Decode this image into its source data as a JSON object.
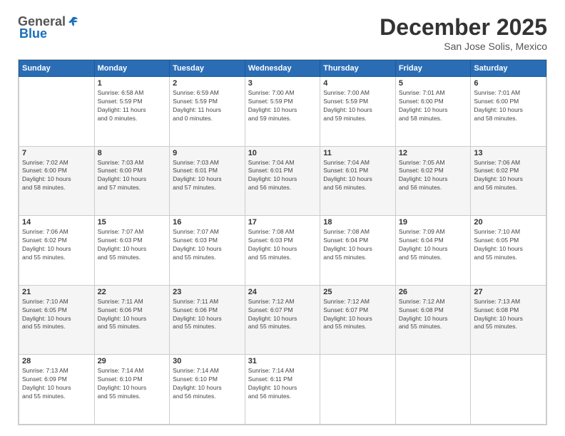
{
  "logo": {
    "general": "General",
    "blue": "Blue"
  },
  "title": "December 2025",
  "location": "San Jose Solis, Mexico",
  "days_header": [
    "Sunday",
    "Monday",
    "Tuesday",
    "Wednesday",
    "Thursday",
    "Friday",
    "Saturday"
  ],
  "weeks": [
    [
      {
        "day": "",
        "info": ""
      },
      {
        "day": "1",
        "info": "Sunrise: 6:58 AM\nSunset: 5:59 PM\nDaylight: 11 hours\nand 0 minutes."
      },
      {
        "day": "2",
        "info": "Sunrise: 6:59 AM\nSunset: 5:59 PM\nDaylight: 11 hours\nand 0 minutes."
      },
      {
        "day": "3",
        "info": "Sunrise: 7:00 AM\nSunset: 5:59 PM\nDaylight: 10 hours\nand 59 minutes."
      },
      {
        "day": "4",
        "info": "Sunrise: 7:00 AM\nSunset: 5:59 PM\nDaylight: 10 hours\nand 59 minutes."
      },
      {
        "day": "5",
        "info": "Sunrise: 7:01 AM\nSunset: 6:00 PM\nDaylight: 10 hours\nand 58 minutes."
      },
      {
        "day": "6",
        "info": "Sunrise: 7:01 AM\nSunset: 6:00 PM\nDaylight: 10 hours\nand 58 minutes."
      }
    ],
    [
      {
        "day": "7",
        "info": "Sunrise: 7:02 AM\nSunset: 6:00 PM\nDaylight: 10 hours\nand 58 minutes."
      },
      {
        "day": "8",
        "info": "Sunrise: 7:03 AM\nSunset: 6:00 PM\nDaylight: 10 hours\nand 57 minutes."
      },
      {
        "day": "9",
        "info": "Sunrise: 7:03 AM\nSunset: 6:01 PM\nDaylight: 10 hours\nand 57 minutes."
      },
      {
        "day": "10",
        "info": "Sunrise: 7:04 AM\nSunset: 6:01 PM\nDaylight: 10 hours\nand 56 minutes."
      },
      {
        "day": "11",
        "info": "Sunrise: 7:04 AM\nSunset: 6:01 PM\nDaylight: 10 hours\nand 56 minutes."
      },
      {
        "day": "12",
        "info": "Sunrise: 7:05 AM\nSunset: 6:02 PM\nDaylight: 10 hours\nand 56 minutes."
      },
      {
        "day": "13",
        "info": "Sunrise: 7:06 AM\nSunset: 6:02 PM\nDaylight: 10 hours\nand 56 minutes."
      }
    ],
    [
      {
        "day": "14",
        "info": "Sunrise: 7:06 AM\nSunset: 6:02 PM\nDaylight: 10 hours\nand 55 minutes."
      },
      {
        "day": "15",
        "info": "Sunrise: 7:07 AM\nSunset: 6:03 PM\nDaylight: 10 hours\nand 55 minutes."
      },
      {
        "day": "16",
        "info": "Sunrise: 7:07 AM\nSunset: 6:03 PM\nDaylight: 10 hours\nand 55 minutes."
      },
      {
        "day": "17",
        "info": "Sunrise: 7:08 AM\nSunset: 6:03 PM\nDaylight: 10 hours\nand 55 minutes."
      },
      {
        "day": "18",
        "info": "Sunrise: 7:08 AM\nSunset: 6:04 PM\nDaylight: 10 hours\nand 55 minutes."
      },
      {
        "day": "19",
        "info": "Sunrise: 7:09 AM\nSunset: 6:04 PM\nDaylight: 10 hours\nand 55 minutes."
      },
      {
        "day": "20",
        "info": "Sunrise: 7:10 AM\nSunset: 6:05 PM\nDaylight: 10 hours\nand 55 minutes."
      }
    ],
    [
      {
        "day": "21",
        "info": "Sunrise: 7:10 AM\nSunset: 6:05 PM\nDaylight: 10 hours\nand 55 minutes."
      },
      {
        "day": "22",
        "info": "Sunrise: 7:11 AM\nSunset: 6:06 PM\nDaylight: 10 hours\nand 55 minutes."
      },
      {
        "day": "23",
        "info": "Sunrise: 7:11 AM\nSunset: 6:06 PM\nDaylight: 10 hours\nand 55 minutes."
      },
      {
        "day": "24",
        "info": "Sunrise: 7:12 AM\nSunset: 6:07 PM\nDaylight: 10 hours\nand 55 minutes."
      },
      {
        "day": "25",
        "info": "Sunrise: 7:12 AM\nSunset: 6:07 PM\nDaylight: 10 hours\nand 55 minutes."
      },
      {
        "day": "26",
        "info": "Sunrise: 7:12 AM\nSunset: 6:08 PM\nDaylight: 10 hours\nand 55 minutes."
      },
      {
        "day": "27",
        "info": "Sunrise: 7:13 AM\nSunset: 6:08 PM\nDaylight: 10 hours\nand 55 minutes."
      }
    ],
    [
      {
        "day": "28",
        "info": "Sunrise: 7:13 AM\nSunset: 6:09 PM\nDaylight: 10 hours\nand 55 minutes."
      },
      {
        "day": "29",
        "info": "Sunrise: 7:14 AM\nSunset: 6:10 PM\nDaylight: 10 hours\nand 55 minutes."
      },
      {
        "day": "30",
        "info": "Sunrise: 7:14 AM\nSunset: 6:10 PM\nDaylight: 10 hours\nand 56 minutes."
      },
      {
        "day": "31",
        "info": "Sunrise: 7:14 AM\nSunset: 6:11 PM\nDaylight: 10 hours\nand 56 minutes."
      },
      {
        "day": "",
        "info": ""
      },
      {
        "day": "",
        "info": ""
      },
      {
        "day": "",
        "info": ""
      }
    ]
  ]
}
